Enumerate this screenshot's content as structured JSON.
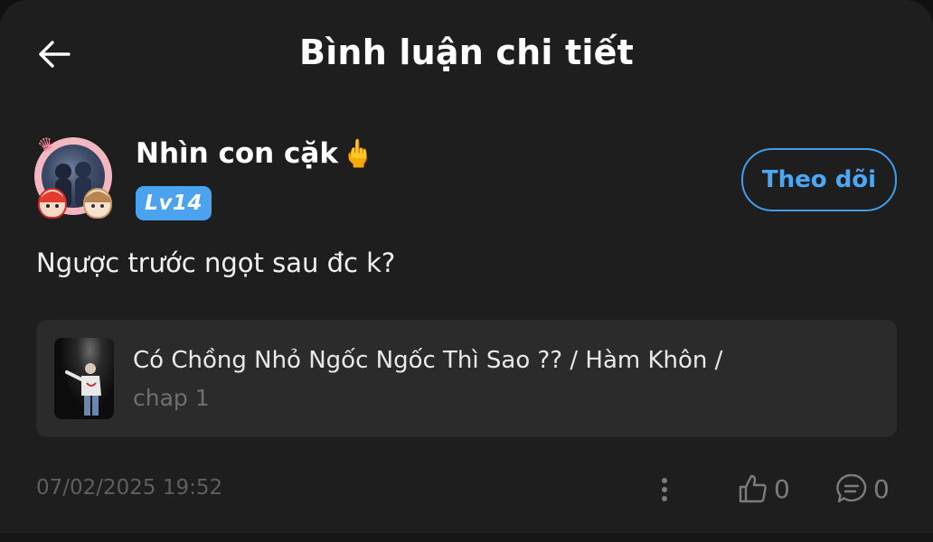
{
  "header": {
    "title": "Bình luận chi tiết"
  },
  "comment": {
    "user": {
      "name": "Nhìn con cặk",
      "name_emoji": "🖕",
      "level_badge": "Lv14"
    },
    "follow_label": "Theo dõi",
    "text": "Ngược trước ngọt sau đc k?",
    "book": {
      "title": "Có Chồng Nhỏ Ngốc Ngốc Thì Sao ?? / Hàm Khôn /",
      "chapter": "chap 1"
    },
    "timestamp": "07/02/2025 19:52",
    "like_count": "0",
    "reply_count": "0"
  },
  "colors": {
    "background": "#1e1e1e",
    "accent": "#4aa8f5",
    "badge": "#4ba3ef",
    "card": "#2b2b2b",
    "muted": "#6f6f6f"
  },
  "icons": {
    "back": "arrow-left-icon",
    "more": "more-vertical-icon",
    "like": "thumbs-up-icon",
    "reply": "comment-icon"
  }
}
